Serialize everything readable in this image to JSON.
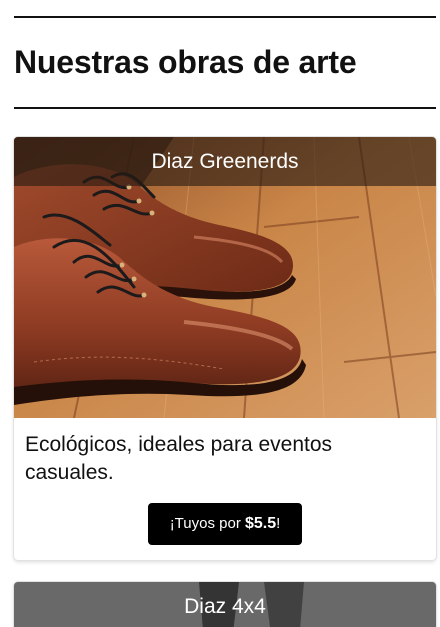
{
  "section": {
    "title": "Nuestras obras de arte"
  },
  "products": [
    {
      "name": "Diaz Greenerds",
      "description": "Ecológicos, ideales para eventos casuales.",
      "button_prefix": "¡Tuyos por ",
      "price": "$5.5",
      "button_suffix": "!",
      "image": "brown-leather-boots-photo"
    },
    {
      "name": "Diaz 4x4",
      "image": "shoe-photo-grey"
    }
  ],
  "colors": {
    "button_background": "#000000",
    "button_text": "#ffffff",
    "label_overlay": "#281c14"
  }
}
